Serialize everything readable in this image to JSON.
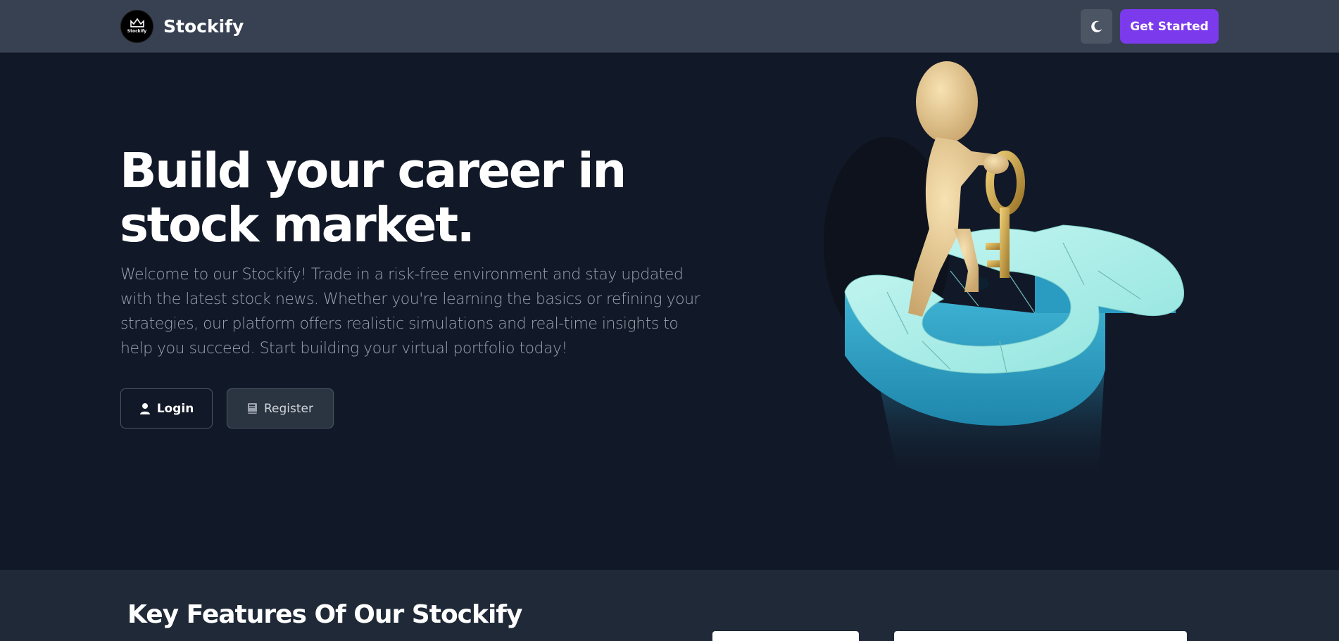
{
  "navbar": {
    "brand_name": "Stockify",
    "logo_text": "Stockify",
    "theme_toggle_icon": "moon-icon",
    "get_started_label": "Get Started"
  },
  "hero": {
    "title_line1": "Build your career in",
    "title_line2": "stock market.",
    "description": "Welcome to our Stockify! Trade in a risk-free environment and stay updated with the latest stock news. Whether you're learning the basics or refining your strategies, our platform offers realistic simulations and real-time insights to help you succeed. Start building your virtual portfolio today!",
    "login_label": "Login",
    "login_icon": "user-icon",
    "register_label": "Register",
    "register_icon": "book-icon",
    "illustration": "figure-with-key-on-dollar-puzzle"
  },
  "features": {
    "title": "Key Features Of Our Stockify"
  },
  "colors": {
    "navbar_bg": "#374151",
    "page_bg": "#111827",
    "accent": "#7c3aed",
    "text_muted": "#9ca3af",
    "features_bg": "#1f2937"
  }
}
